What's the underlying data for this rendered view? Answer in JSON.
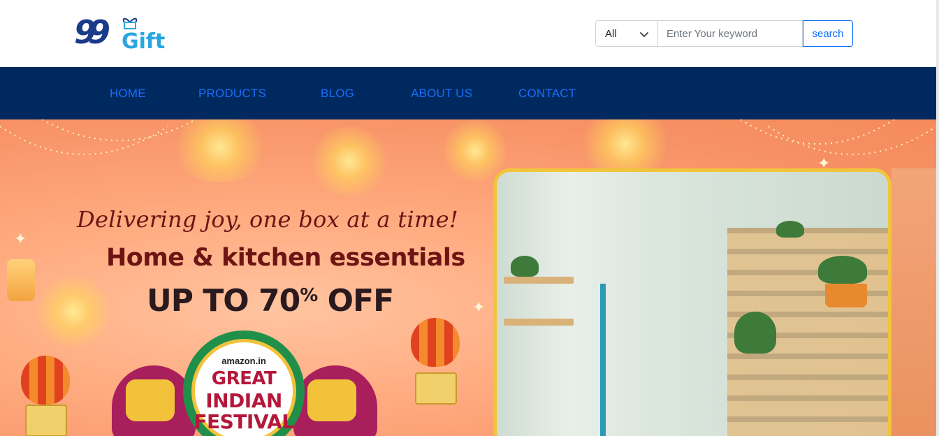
{
  "brand": {
    "logo_digits": "99",
    "logo_word": "Gift",
    "colors": {
      "primary_dark": "#1a3a8a",
      "primary_light": "#27a6e0"
    }
  },
  "search": {
    "category_value": "All",
    "placeholder": "Enter Your keyword",
    "button_label": "search"
  },
  "nav": {
    "background": "#002a5f",
    "link_color": "#1b6dfb",
    "items": [
      {
        "label": "HOME"
      },
      {
        "label": "PRODUCTS"
      },
      {
        "label": "BLOG"
      },
      {
        "label": "ABOUT US"
      },
      {
        "label": "CONTACT"
      }
    ]
  },
  "banner": {
    "tagline": "Delivering joy, one box at a time!",
    "subhead": "Home & kitchen essentials",
    "offer_prefix": "UP TO 70",
    "offer_percent": "%",
    "offer_suffix": " OFF",
    "badge": {
      "store": "amazon.in",
      "line1": "GREAT",
      "line2": "INDIAN",
      "line3": "FESTIVAL"
    }
  }
}
